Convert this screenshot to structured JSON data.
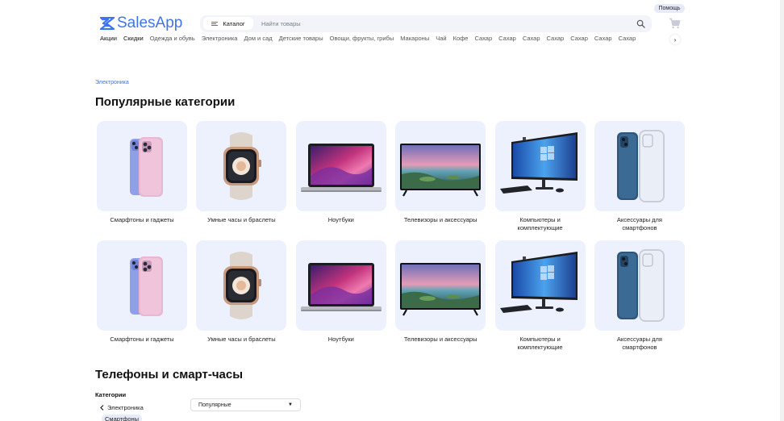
{
  "header": {
    "help_label": "Помощь",
    "logo_text": "SalesApp",
    "catalog_label": "Каталог",
    "search_placeholder": "Найти товары"
  },
  "category_nav": {
    "items": [
      {
        "label": "Акции",
        "bold": true
      },
      {
        "label": "Скидки",
        "bold": true
      },
      {
        "label": "Одежда и обувь",
        "bold": false
      },
      {
        "label": "Электроника",
        "bold": false
      },
      {
        "label": "Дом и сад",
        "bold": false
      },
      {
        "label": "Детские товары",
        "bold": false
      },
      {
        "label": "Овощи, фрукты, грибы",
        "bold": false
      },
      {
        "label": "Макароны",
        "bold": false
      },
      {
        "label": "Чай",
        "bold": false
      },
      {
        "label": "Кофе",
        "bold": false
      },
      {
        "label": "Сахар",
        "bold": false
      },
      {
        "label": "Сахар",
        "bold": false
      },
      {
        "label": "Сахар",
        "bold": false
      },
      {
        "label": "Сахар",
        "bold": false
      },
      {
        "label": "Сахар",
        "bold": false
      },
      {
        "label": "Сахар",
        "bold": false
      },
      {
        "label": "Сахар",
        "bold": false
      }
    ],
    "next_arrow": "›"
  },
  "breadcrumb": "Электроника",
  "popular": {
    "title": "Популярные категории",
    "rows": [
      [
        {
          "label": "Смарфтоны и гаджеты",
          "icon": "phone-image"
        },
        {
          "label": "Умные часы и браслеты",
          "icon": "watch-image"
        },
        {
          "label": "Ноутбуки",
          "icon": "laptop-image"
        },
        {
          "label": "Телевизоры и аксессуары",
          "icon": "tv-image"
        },
        {
          "label": "Компьютеры и комплектующие",
          "icon": "computer-image"
        },
        {
          "label": "Аксессуары для смартфонов",
          "icon": "phone-case-image"
        }
      ],
      [
        {
          "label": "Смарфтоны и гаджеты",
          "icon": "phone-image"
        },
        {
          "label": "Умные часы и браслеты",
          "icon": "watch-image"
        },
        {
          "label": "Ноутбуки",
          "icon": "laptop-image"
        },
        {
          "label": "Телевизоры и аксессуары",
          "icon": "tv-image"
        },
        {
          "label": "Компьютеры и комплектующие",
          "icon": "computer-image"
        },
        {
          "label": "Аксессуары для смартфонов",
          "icon": "phone-case-image"
        }
      ]
    ]
  },
  "section2": {
    "title": "Телефоны и смарт-часы",
    "filter_title": "Категории",
    "filter_back": "Электроника",
    "filter_chip": "Смартфоны",
    "sort_value": "Популярные"
  },
  "colors": {
    "accent": "#3f74f0",
    "tile_bg": "#edf0fd",
    "search_bg": "#f3f4f9"
  }
}
